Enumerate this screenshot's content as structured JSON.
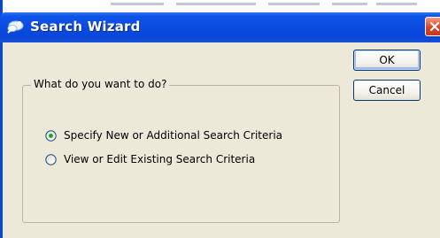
{
  "window": {
    "title": "Search Wizard",
    "title_bar_color": "#0a46d8",
    "icon": "search-wizard-app-icon",
    "close_icon": "close-icon"
  },
  "buttons": {
    "ok_label": "OK",
    "cancel_label": "Cancel"
  },
  "group": {
    "legend": "What do you want to do?",
    "options": [
      {
        "label": "Specify New or Additional Search Criteria",
        "selected": true
      },
      {
        "label": "View or Edit Existing Search Criteria",
        "selected": false
      }
    ]
  }
}
